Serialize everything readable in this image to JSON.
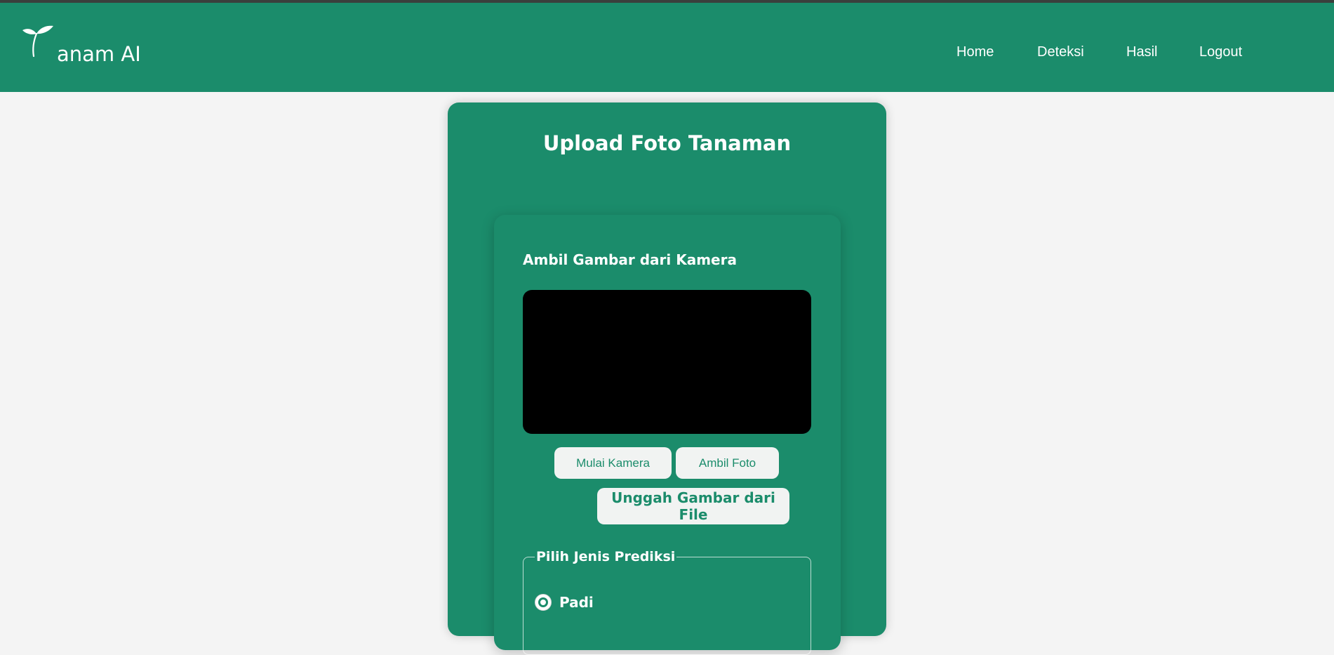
{
  "brand": {
    "name": "anam AI",
    "logo_icon": "sprout-icon"
  },
  "nav": {
    "items": [
      {
        "label": "Home"
      },
      {
        "label": "Deteksi"
      },
      {
        "label": "Hasil"
      },
      {
        "label": "Logout"
      }
    ]
  },
  "card": {
    "title": "Upload Foto Tanaman",
    "camera_section_label": "Ambil Gambar dari Kamera",
    "buttons": {
      "start_camera": "Mulai Kamera",
      "capture_photo": "Ambil Foto",
      "upload_file": "Unggah Gambar dari File"
    },
    "prediction": {
      "legend": "Pilih Jenis Prediksi",
      "options": [
        {
          "label": "Padi",
          "selected": true
        }
      ]
    }
  },
  "colors": {
    "primary": "#1b8c6b",
    "background": "#f4f4f4",
    "button_bg": "#f1f3f2",
    "video_bg": "#000000",
    "text_light": "#ffffff"
  }
}
